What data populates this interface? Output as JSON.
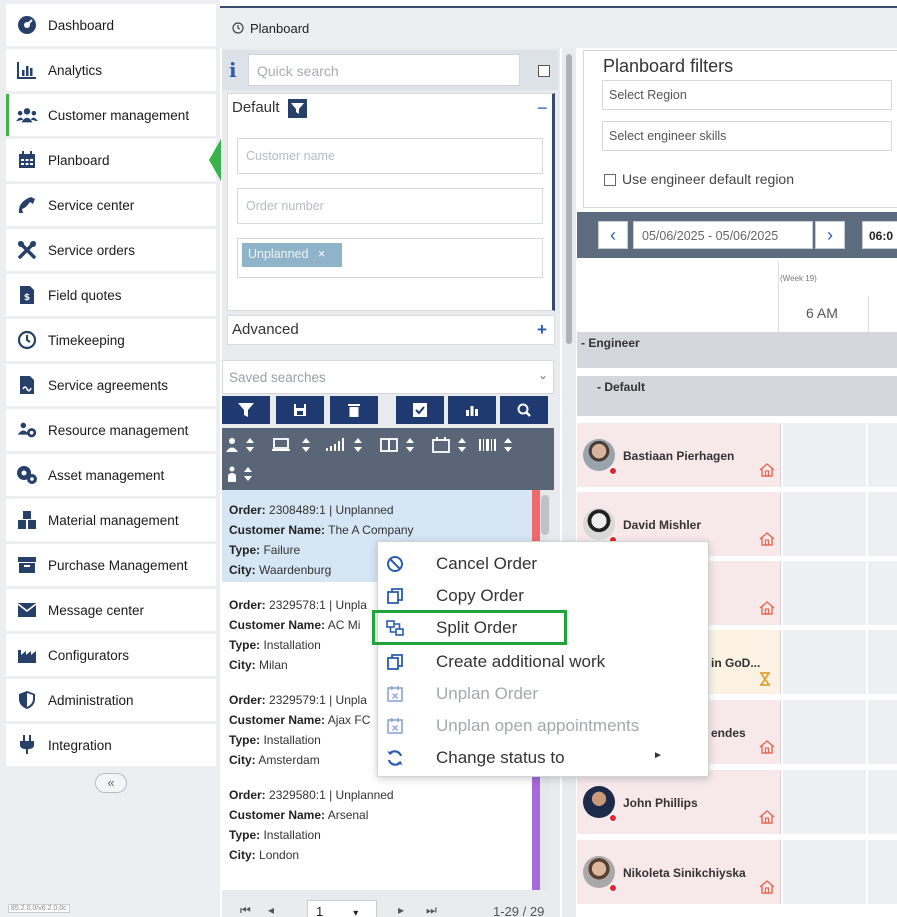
{
  "sidebar": {
    "items": [
      {
        "label": "Dashboard",
        "icon": "dashboard-icon"
      },
      {
        "label": "Analytics",
        "icon": "analytics-icon"
      },
      {
        "label": "Customer management",
        "icon": "users-icon"
      },
      {
        "label": "Planboard",
        "icon": "calendar-icon",
        "active": true
      },
      {
        "label": "Service center",
        "icon": "phone-icon"
      },
      {
        "label": "Service orders",
        "icon": "tools-icon"
      },
      {
        "label": "Field quotes",
        "icon": "quote-document-icon"
      },
      {
        "label": "Timekeeping",
        "icon": "clock-icon"
      },
      {
        "label": "Service agreements",
        "icon": "agreement-icon"
      },
      {
        "label": "Resource management",
        "icon": "resource-users-icon"
      },
      {
        "label": "Asset management",
        "icon": "asset-gear-icon"
      },
      {
        "label": "Material management",
        "icon": "boxes-icon"
      },
      {
        "label": "Purchase Management",
        "icon": "purchase-box-icon"
      },
      {
        "label": "Message center",
        "icon": "envelope-icon"
      },
      {
        "label": "Configurators",
        "icon": "factory-icon"
      },
      {
        "label": "Administration",
        "icon": "shield-icon"
      },
      {
        "label": "Integration",
        "icon": "plug-icon"
      }
    ],
    "collapse_label": "«",
    "version": "85.2.0.0/v6.2.0.0c"
  },
  "header": {
    "title": "Planboard"
  },
  "search": {
    "quick_search_placeholder": "Quick search",
    "default_label": "Default",
    "customer_name_placeholder": "Customer name",
    "order_number_placeholder": "Order number",
    "status_chip": "Unplanned",
    "status_chip_remove": "×",
    "advanced_label": "Advanced",
    "saved_searches_placeholder": "Saved searches"
  },
  "orders": [
    {
      "order_label": "Order:",
      "order": "2308489:1 | Unplanned",
      "customer_label": "Customer Name:",
      "customer": "The A Company",
      "type_label": "Type:",
      "type": "Failure",
      "city_label": "City:",
      "city": "Waardenburg",
      "stripe": "#ef6b6b"
    },
    {
      "order_label": "Order:",
      "order": "2329578:1 | Unpla",
      "customer_label": "Customer Name:",
      "customer": "AC Mi",
      "type_label": "Type:",
      "type": "Installation",
      "city_label": "City:",
      "city": "Milan",
      "stripe": ""
    },
    {
      "order_label": "Order:",
      "order": "2329579:1 | Unpla",
      "customer_label": "Customer Name:",
      "customer": "Ajax FC",
      "type_label": "Type:",
      "type": "Installation",
      "city_label": "City:",
      "city": "Amsterdam",
      "stripe": ""
    },
    {
      "order_label": "Order:",
      "order": "2329580:1 | Unplanned",
      "customer_label": "Customer Name:",
      "customer": "Arsenal",
      "type_label": "Type:",
      "type": "Installation",
      "city_label": "City:",
      "city": "London",
      "stripe": "#a66bd6"
    }
  ],
  "pager": {
    "page": "1",
    "count": "1-29 / 29"
  },
  "planboard": {
    "filters_title": "Planboard filters",
    "select_region": "Select Region",
    "select_skills": "Select engineer skills",
    "use_default_region": "Use engineer default region",
    "date_range": "05/06/2025 - 05/06/2025",
    "time_value": "06:0",
    "week_label": "(Week 19)",
    "hour_label": "6 AM",
    "engineer_header": "- Engineer",
    "default_group": "- Default",
    "engineers": [
      {
        "name": "Bastiaan Pierhagen",
        "status": "red"
      },
      {
        "name": "David Mishler",
        "status": "red"
      },
      {
        "name": "",
        "status": "red"
      },
      {
        "name": "in GoD...",
        "status": "warning"
      },
      {
        "name": "endes",
        "status": "red"
      },
      {
        "name": "John Phillips",
        "status": "red"
      },
      {
        "name": "Nikoleta Sinikchiyska",
        "status": "red"
      }
    ]
  },
  "context_menu": {
    "items": [
      {
        "label": "Cancel Order",
        "icon": "cancel-icon",
        "enabled": true
      },
      {
        "label": "Copy Order",
        "icon": "copy-icon",
        "enabled": true
      },
      {
        "label": "Split Order",
        "icon": "split-icon",
        "enabled": true,
        "highlighted": true
      },
      {
        "label": "Create additional work",
        "icon": "additional-work-icon",
        "enabled": true
      },
      {
        "label": "Unplan Order",
        "icon": "unplan-calendar-icon",
        "enabled": false
      },
      {
        "label": "Unplan open appointments",
        "icon": "unplan-appointments-icon",
        "enabled": false
      },
      {
        "label": "Change status to",
        "icon": "refresh-icon",
        "enabled": true,
        "submenu": true
      }
    ]
  },
  "colors": {
    "accent_navy": "#1f3a70",
    "active_green": "#37b24d",
    "highlight_green": "#1fa33b",
    "alert_red": "#e0262c"
  }
}
